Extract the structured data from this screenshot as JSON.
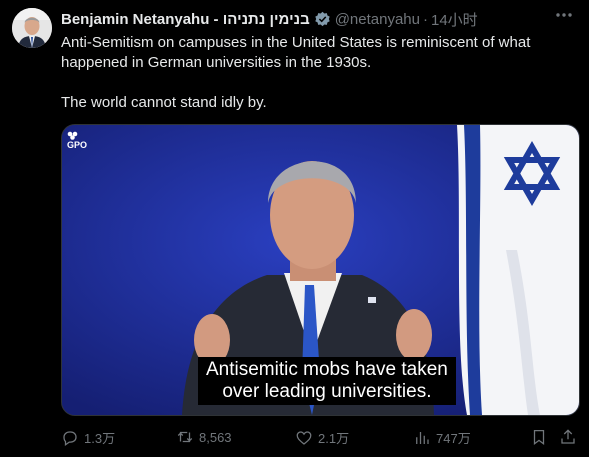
{
  "author": {
    "display_name": "Benjamin Netanyahu - בנימין נתניהו",
    "handle": "@netanyahu",
    "separator": "·",
    "time": "14小时",
    "verified": true,
    "avatar_icon": "profile-photo"
  },
  "more_icon": "more-horizontal-icon",
  "post": {
    "paragraphs": [
      "Anti-Semitism on campuses in the United States is reminiscent of what happened in German universities in the 1930s.",
      "The world cannot stand idly by."
    ]
  },
  "media": {
    "watermark": "GPO",
    "caption_line1": "Antisemitic mobs have taken",
    "caption_line2": "over leading universities."
  },
  "actions": {
    "reply_count": "1.3万",
    "repost_count": "8,563",
    "like_count": "2.1万",
    "view_count": "747万"
  },
  "colors": {
    "background": "#000000",
    "text": "#e7e9ea",
    "muted": "#71767b",
    "verified_badge": "#829aab",
    "media_blue": "#1c2a8a",
    "flag_blue": "#1e3c9c"
  }
}
